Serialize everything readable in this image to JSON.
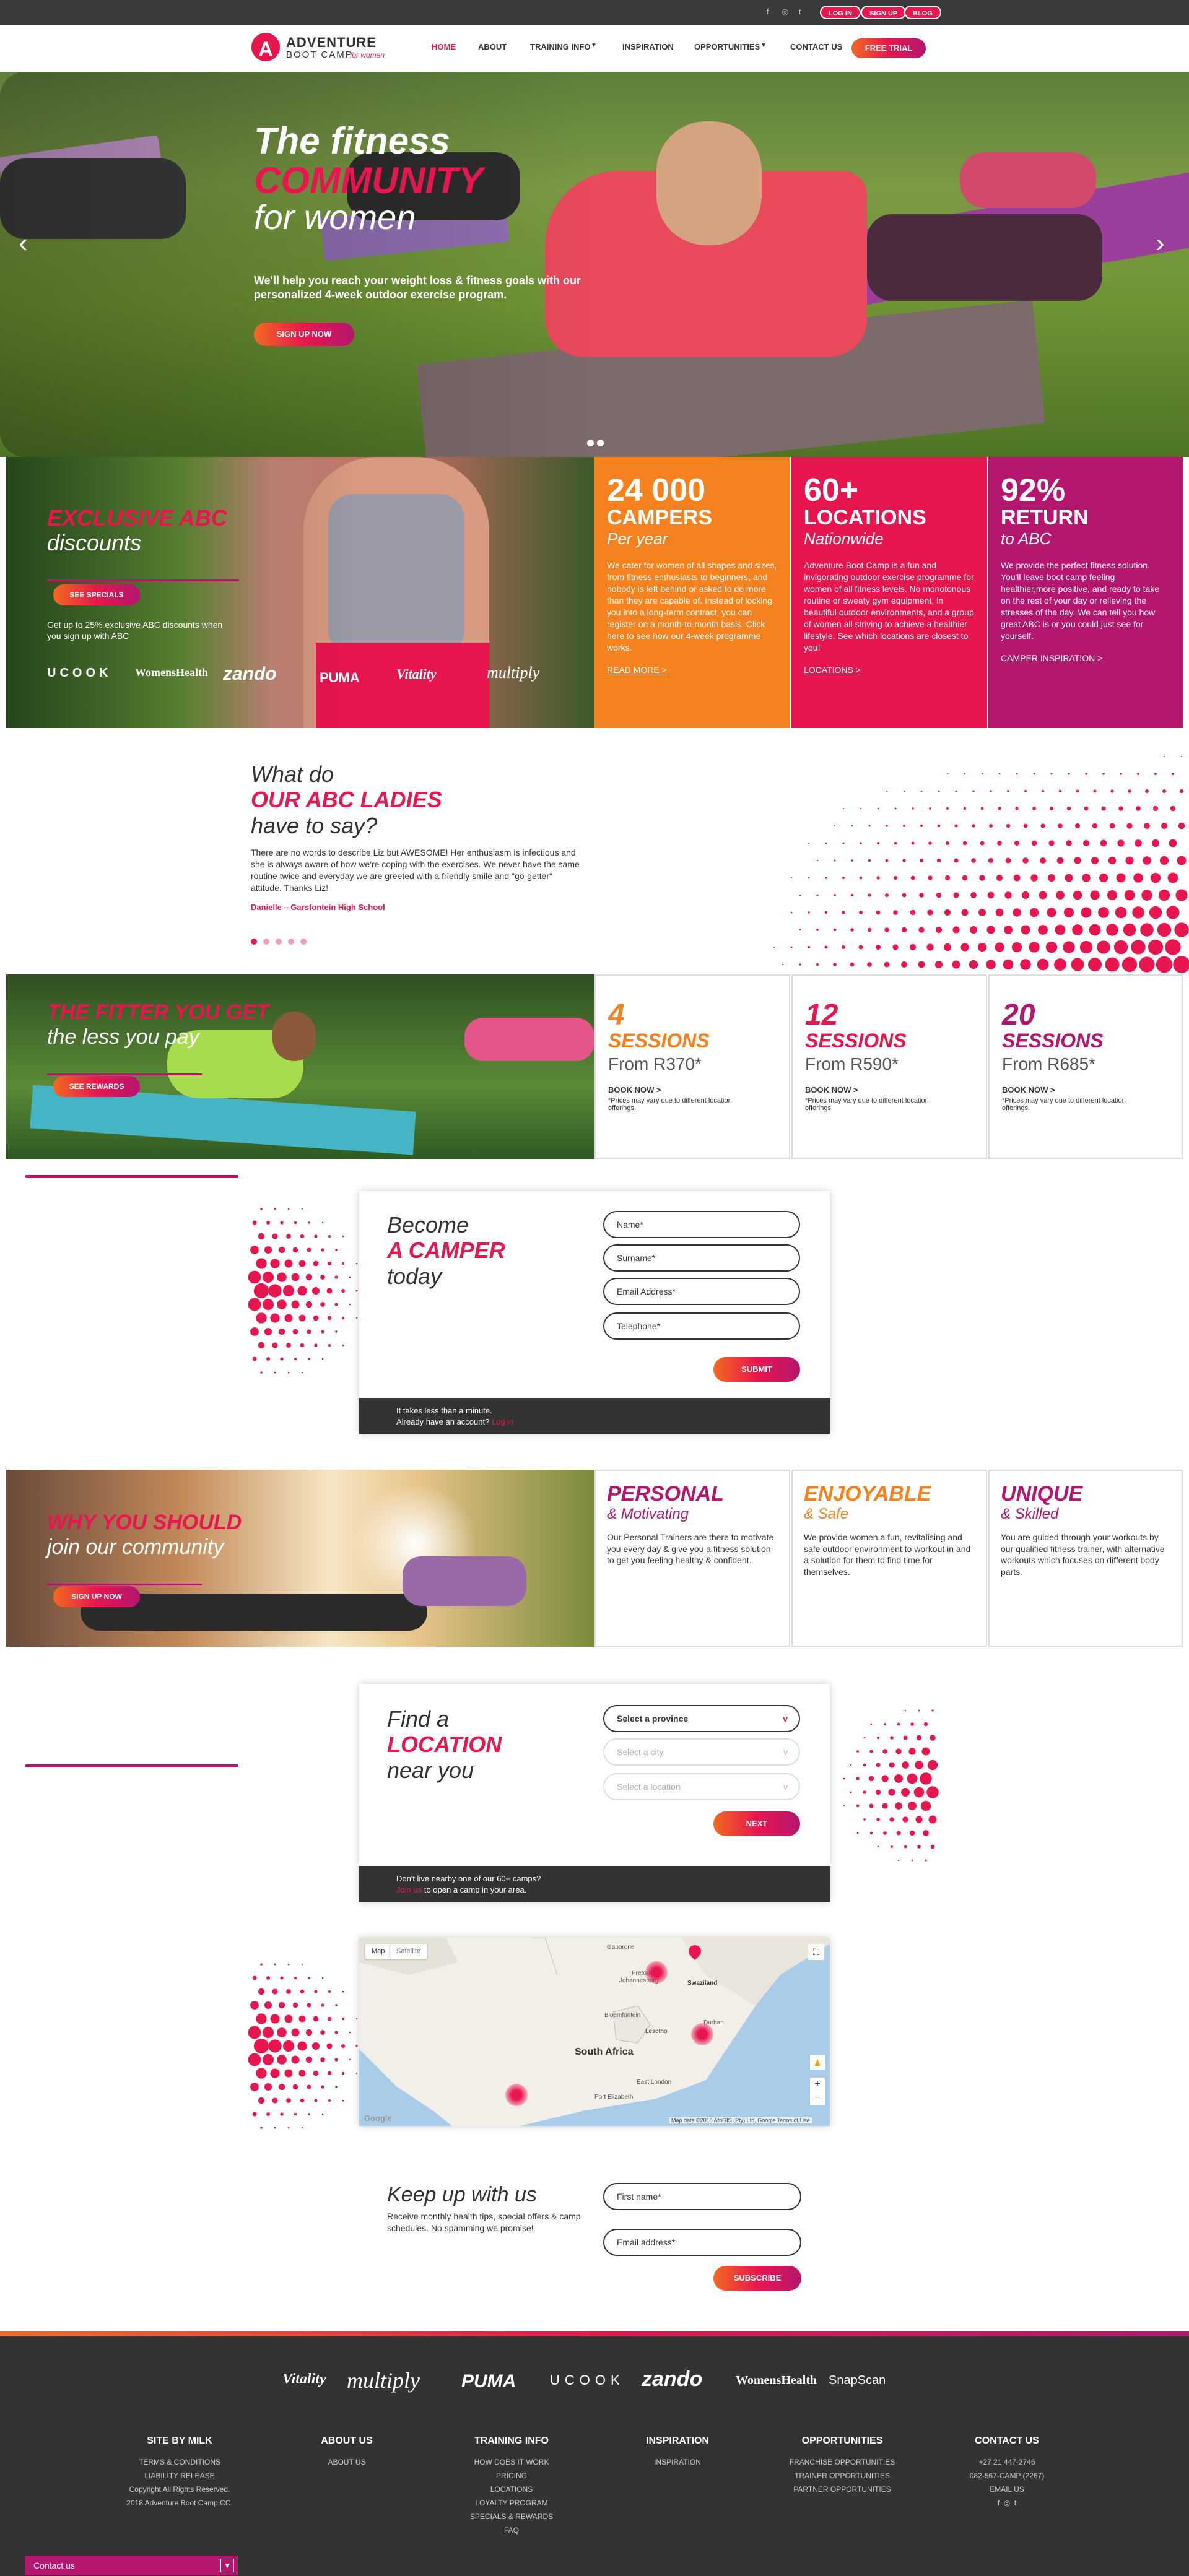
{
  "topbar": {
    "social": [
      "f",
      "◎",
      "t"
    ],
    "login": "LOG IN",
    "signup": "SIGN UP",
    "blog": "BLOG"
  },
  "nav": {
    "brand_line1": "ADVENTURE",
    "brand_line2": "BOOT CAMP",
    "brand_line3": "for women",
    "logo_letter": "A",
    "items": [
      "HOME",
      "ABOUT",
      "TRAINING INFO",
      "INSPIRATION",
      "OPPORTUNITIES",
      "CONTACT US"
    ],
    "trial": "FREE TRIAL",
    "active_color": "#e8164e"
  },
  "hero": {
    "line1": "The fitness",
    "line2": "COMMUNITY",
    "line3": "for women",
    "body": "We'll help you reach your weight loss & fitness goals with our personalized 4-week outdoor exercise program.",
    "cta": "SIGN UP NOW"
  },
  "discounts": {
    "title1": "EXCLUSIVE ABC",
    "title2": "discounts",
    "cta": "SEE SPECIALS",
    "body": "Get up to 25% exclusive ABC discounts when you sign up with ABC",
    "brands": [
      "UCOOK",
      "WomensHealth",
      "zando",
      "PUMA",
      "Vitality",
      "multiply"
    ]
  },
  "stats": [
    {
      "big": "24 000",
      "h": "CAMPERS",
      "sub": "Per year",
      "body": "We cater for women of all shapes and sizes, from fitness enthusiasts to beginners, and nobody is left behind or asked to do more than they are capable of. Instead of locking you into a long-term contract, you can register on a month-to-month basis. Click here to see how our 4-week programme works.",
      "more": "READ MORE >",
      "color": "#f5821f"
    },
    {
      "big": "60+",
      "h": "LOCATIONS",
      "sub": "Nationwide",
      "body": "Adventure Boot Camp is a fun and invigorating outdoor exercise programme for women of all fitness levels. No monotonous routine or sweaty gym equipment, in beautiful outdoor environments, and a group of women all striving to achieve a healthier lifestyle. See which locations are closest to you!",
      "more": "LOCATIONS >",
      "color": "#e8164e"
    },
    {
      "big": "92%",
      "h": "RETURN",
      "sub": "to ABC",
      "body": "We provide the perfect fitness solution. You'll leave boot camp feeling healthier,more positive, and ready to take on the rest of your day or relieving the stresses of the day. We can tell you how great ABC is or you could just see for yourself.",
      "more": "CAMPER INSPIRATION >",
      "color": "#b5176f"
    }
  ],
  "testimonial": {
    "l1": "What do",
    "l2": "OUR ABC LADIES",
    "l3": "have to say?",
    "quote": "There are no words to describe Liz but AWESOME! Her enthusiasm is infectious and she is always aware of how we're coping with the exercises. We never have the same routine twice and everyday we are greeted with a friendly smile and \"go-getter\" attitude. Thanks Liz!",
    "author": "Danielle – Garsfontein High School"
  },
  "fitter": {
    "t1": "THE FITTER YOU GET",
    "t2": "the less you pay",
    "cta": "SEE REWARDS"
  },
  "sessions": [
    {
      "n": "4",
      "s": "SESSIONS",
      "p": "From R370*",
      "bk": "BOOK NOW >",
      "note": "*Prices may vary due to different location offerings.",
      "color": "#f5821f"
    },
    {
      "n": "12",
      "s": "SESSIONS",
      "p": "From R590*",
      "bk": "BOOK NOW >",
      "note": "*Prices may vary due to different location offerings.",
      "color": "#e8164e"
    },
    {
      "n": "20",
      "s": "SESSIONS",
      "p": "From R685*",
      "bk": "BOOK NOW >",
      "note": "*Prices may vary due to different location offerings.",
      "color": "#b5176f"
    }
  ],
  "camper": {
    "l1": "Become",
    "l2": "A CAMPER",
    "l3": "today",
    "fields": [
      "Name*",
      "Surname*",
      "Email Address*",
      "Telephone*"
    ],
    "submit": "SUBMIT",
    "foot1": "It takes less than a minute.",
    "foot2": "Already have an account?",
    "login": "Log in"
  },
  "why": {
    "t1": "WHY YOU SHOULD",
    "t2": "join our community",
    "cta": "SIGN UP NOW",
    "cols": [
      {
        "t": "PERSONAL",
        "st": "& Motivating",
        "body": "Our Personal Trainers are there to motivate you every day & give you a fitness solution to get you feeling healthy & confident.",
        "color": "#b5176f"
      },
      {
        "t": "ENJOYABLE",
        "st": "& Safe",
        "body": "We provide women a fun, revitalising and safe outdoor environment to workout in and a solution for them to find time for themselves.",
        "color": "#f5821f"
      },
      {
        "t": "UNIQUE",
        "st": "& Skilled",
        "body": "You are guided through your workouts by our qualified fitness trainer, with alternative workouts which focuses on different body parts.",
        "color": "#b5176f"
      }
    ]
  },
  "location": {
    "l1": "Find a",
    "l2": "LOCATION",
    "l3": "near you",
    "selects": [
      "Select a province",
      "Select a city",
      "Select a location"
    ],
    "next": "NEXT",
    "foot1": "Don't live nearby one of our 60+ camps?",
    "join": "Join us",
    "foot2": "to open a camp in your area."
  },
  "map": {
    "tab_map": "Map",
    "tab_sat": "Satellite",
    "country": "South Africa",
    "labels": [
      "Gaborone",
      "Pretoria",
      "Johannesburg",
      "Swaziland",
      "Lesotho",
      "Bloemfontein",
      "Durban",
      "East London",
      "Port Elizabeth"
    ],
    "attrib": "Map data ©2018 AfriGIS (Pty) Ltd, Google   Terms of Use",
    "google": "Google"
  },
  "newsletter": {
    "title": "Keep up with us",
    "body": "Receive monthly health tips, special offers & camp schedules.  No spamming we promise!",
    "fields": [
      "First name*",
      "Email address*"
    ],
    "cta": "SUBSCRIBE"
  },
  "footer": {
    "brands": [
      "Vitality",
      "multiply",
      "PUMA",
      "UCOOK",
      "zando",
      "WomensHealth",
      "SnapScan"
    ],
    "cols": [
      {
        "h": "SITE BY MILK",
        "items": [
          "TERMS & CONDITIONS",
          "LIABILITY RELEASE",
          "Copyright All Rights Reserved.",
          "2018 Adventure Boot Camp CC."
        ]
      },
      {
        "h": "ABOUT US",
        "items": [
          "ABOUT US"
        ]
      },
      {
        "h": "TRAINING INFO",
        "items": [
          "HOW DOES IT WORK",
          "PRICING",
          "LOCATIONS",
          "LOYALTY PROGRAM",
          "SPECIALS & REWARDS",
          "FAQ"
        ]
      },
      {
        "h": "INSPIRATION",
        "items": [
          "INSPIRATION"
        ]
      },
      {
        "h": "OPPORTUNITIES",
        "items": [
          "FRANCHISE OPPORTUNITIES",
          "TRAINER OPPORTUNITIES",
          "PARTNER OPPORTUNITIES"
        ]
      },
      {
        "h": "CONTACT US",
        "items": [
          "+27 21 447-2746",
          "082-567-CAMP (2267)",
          "EMAIL US"
        ]
      }
    ],
    "contact_bar": "Contact us"
  }
}
